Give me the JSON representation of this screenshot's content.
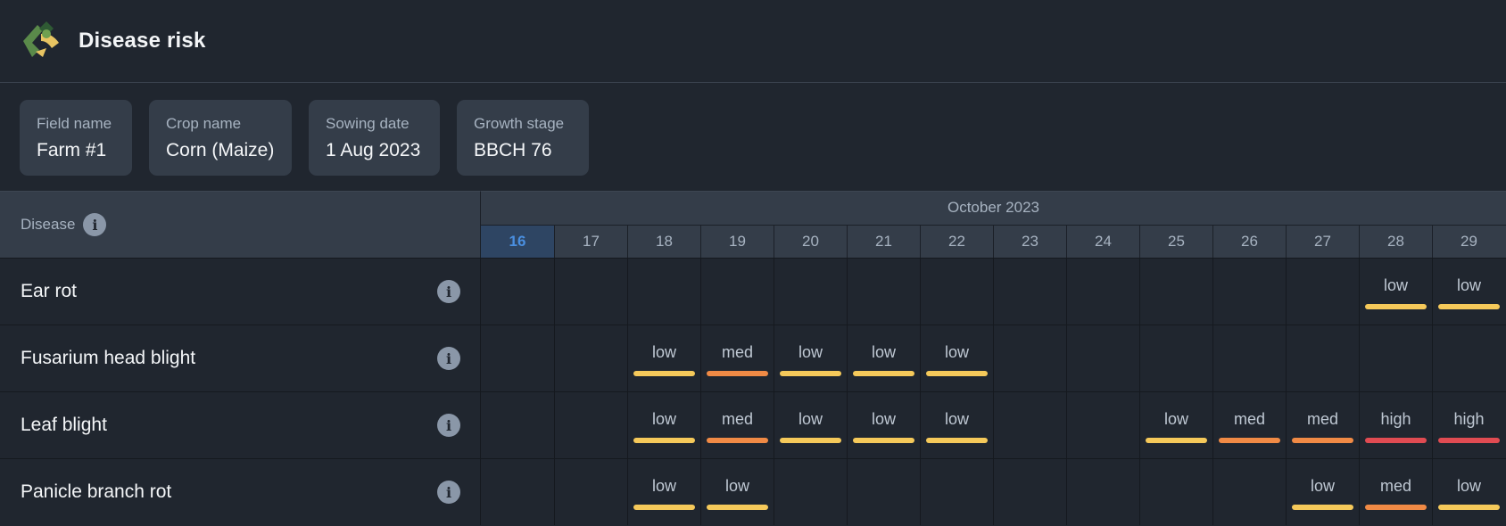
{
  "header": {
    "title": "Disease risk",
    "logo_icon": "leaf-logo-icon"
  },
  "cards": [
    {
      "label": "Field name",
      "value": "Farm #1"
    },
    {
      "label": "Crop name",
      "value": "Corn (Maize)"
    },
    {
      "label": "Sowing date",
      "value": "1 Aug 2023"
    },
    {
      "label": "Growth stage",
      "value": "BBCH 76"
    }
  ],
  "table": {
    "disease_header": "Disease",
    "month": "October 2023",
    "days": [
      "16",
      "17",
      "18",
      "19",
      "20",
      "21",
      "22",
      "23",
      "24",
      "25",
      "26",
      "27",
      "28",
      "29"
    ],
    "today": "16"
  },
  "risk_colors": {
    "low": "#f5c95a",
    "med": "#f08a45",
    "high": "#e04b52"
  },
  "rows": [
    {
      "name": "Ear rot",
      "risks": [
        "",
        "",
        "",
        "",
        "",
        "",
        "",
        "",
        "",
        "",
        "",
        "",
        "low",
        "low"
      ]
    },
    {
      "name": "Fusarium head blight",
      "risks": [
        "",
        "",
        "low",
        "med",
        "low",
        "low",
        "low",
        "",
        "",
        "",
        "",
        "",
        "",
        ""
      ]
    },
    {
      "name": "Leaf blight",
      "risks": [
        "",
        "",
        "low",
        "med",
        "low",
        "low",
        "low",
        "",
        "",
        "low",
        "med",
        "med",
        "high",
        "high"
      ]
    },
    {
      "name": "Panicle branch rot",
      "risks": [
        "",
        "",
        "low",
        "low",
        "",
        "",
        "",
        "",
        "",
        "",
        "",
        "low",
        "med",
        "low"
      ]
    }
  ]
}
